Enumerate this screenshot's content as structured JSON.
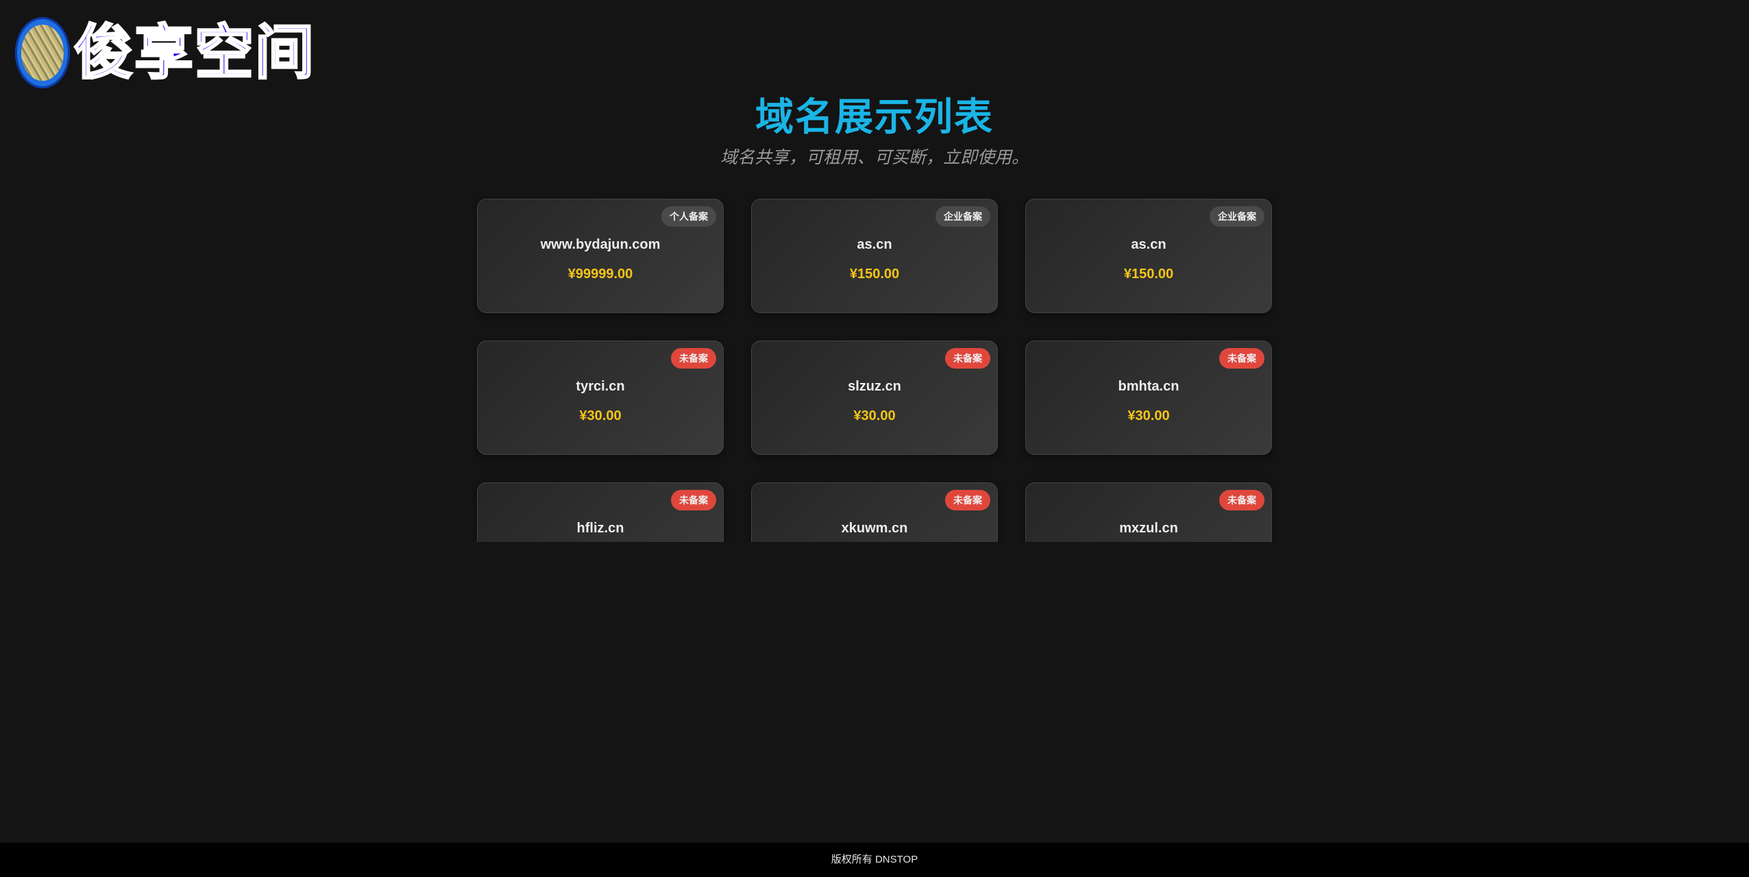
{
  "logo": {
    "text": "俊享空间",
    "icon": "avatar-icon"
  },
  "header": {
    "title": "域名展示列表",
    "subtitle": "域名共享，可租用、可买断，立即使用。"
  },
  "colors": {
    "background": "#141414",
    "title": "#1ab4e6",
    "price": "#f5c518",
    "badge_gray": "#4a4a4a",
    "badge_red": "#e0473c",
    "footer_bg": "#000000",
    "logo_text": "#1a10f0"
  },
  "domains": [
    {
      "name": "www.bydajun.com",
      "price": "¥99999.00",
      "badge": "个人备案",
      "badge_color": "#4a4a4a"
    },
    {
      "name": "as.cn",
      "price": "¥150.00",
      "badge": "企业备案",
      "badge_color": "#4a4a4a"
    },
    {
      "name": "as.cn",
      "price": "¥150.00",
      "badge": "企业备案",
      "badge_color": "#4a4a4a"
    },
    {
      "name": "tyrci.cn",
      "price": "¥30.00",
      "badge": "未备案",
      "badge_color": "#e0473c"
    },
    {
      "name": "slzuz.cn",
      "price": "¥30.00",
      "badge": "未备案",
      "badge_color": "#e0473c"
    },
    {
      "name": "bmhta.cn",
      "price": "¥30.00",
      "badge": "未备案",
      "badge_color": "#e0473c"
    },
    {
      "name": "hfliz.cn",
      "price": "",
      "badge": "未备案",
      "badge_color": "#e0473c"
    },
    {
      "name": "xkuwm.cn",
      "price": "",
      "badge": "未备案",
      "badge_color": "#e0473c"
    },
    {
      "name": "mxzul.cn",
      "price": "",
      "badge": "未备案",
      "badge_color": "#e0473c"
    }
  ],
  "footer": {
    "text": "版权所有 DNSTOP"
  }
}
